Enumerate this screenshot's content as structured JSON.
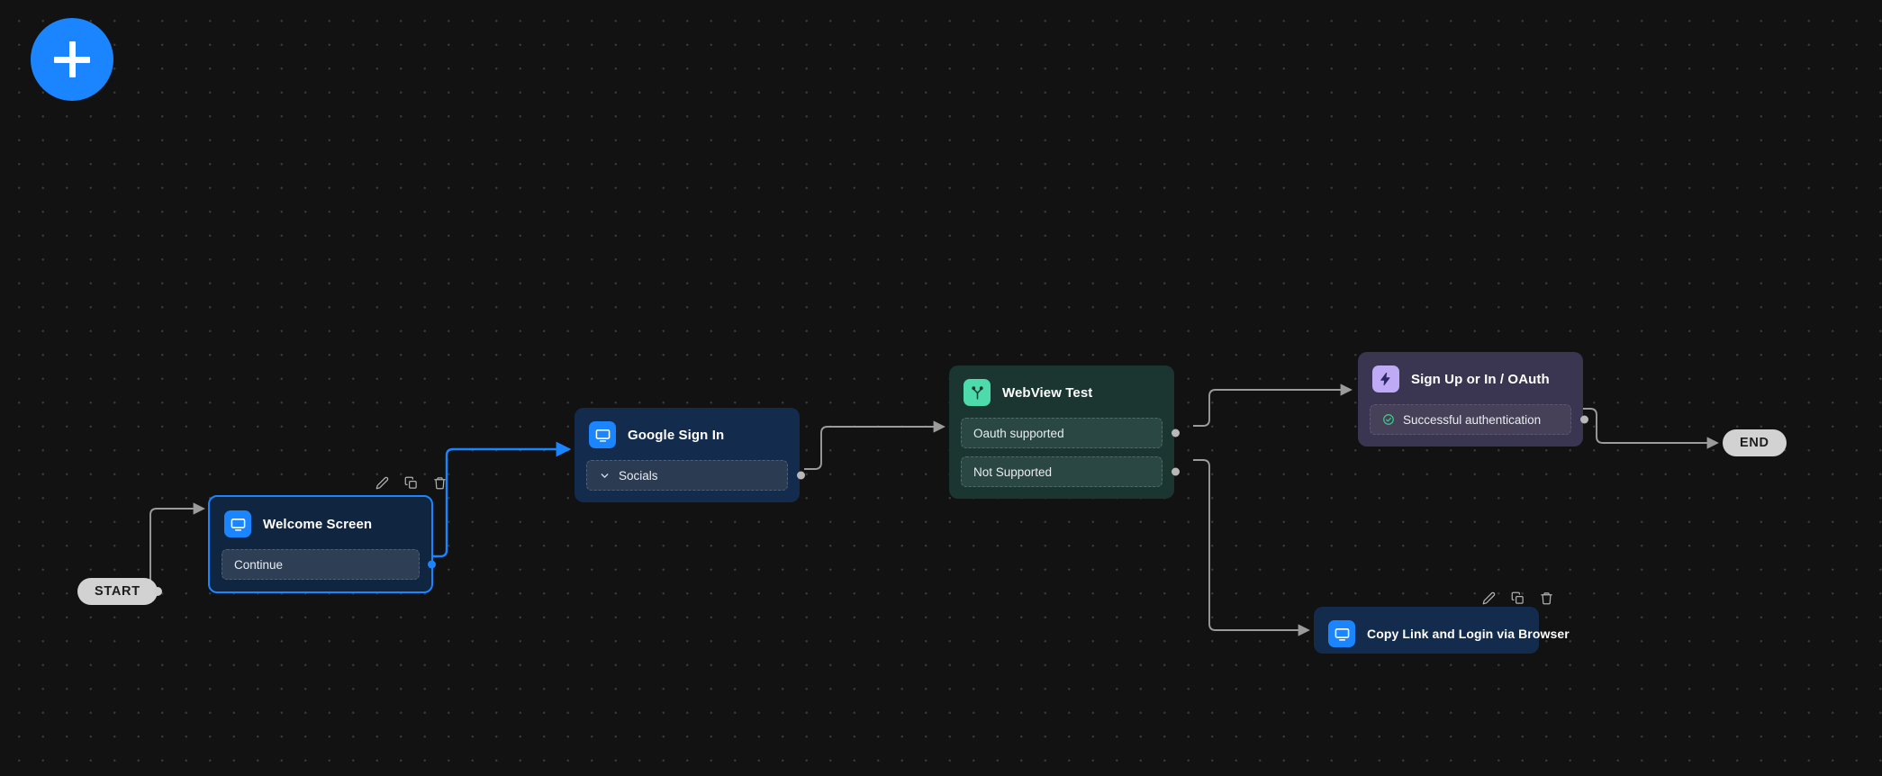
{
  "toolbar_add": {
    "label": "+",
    "icon": "plus-icon",
    "color": "#1a85ff"
  },
  "terminals": {
    "start": {
      "label": "START"
    },
    "end": {
      "label": "END"
    }
  },
  "node_toolbar": {
    "edit_label": "Edit",
    "duplicate_label": "Duplicate",
    "delete_label": "Delete",
    "icons": [
      "pencil-icon",
      "copy-icon",
      "trash-icon"
    ]
  },
  "nodes": [
    {
      "id": "welcome-screen",
      "title": "Welcome Screen",
      "type": "screen",
      "icon": "screen-icon",
      "selected": true,
      "rows": [
        {
          "label": "Continue",
          "icon": null
        }
      ]
    },
    {
      "id": "google-sign-in",
      "title": "Google Sign In",
      "type": "screen",
      "icon": "screen-icon",
      "selected": false,
      "rows": [
        {
          "label": "Socials",
          "icon": "chevron-down-icon"
        }
      ]
    },
    {
      "id": "webview-test",
      "title": "WebView Test",
      "type": "logic",
      "icon": "branch-icon",
      "selected": false,
      "rows": [
        {
          "label": "Oauth supported",
          "icon": null
        },
        {
          "label": "Not Supported",
          "icon": null
        }
      ]
    },
    {
      "id": "sign-up-oauth",
      "title": "Sign Up or In / OAuth",
      "type": "action",
      "icon": "bolt-icon",
      "selected": false,
      "rows": [
        {
          "label": "Successful authentication",
          "icon": "check-circle-icon"
        }
      ]
    },
    {
      "id": "copy-link-browser",
      "title": "Copy Link and Login via Browser",
      "type": "screen",
      "icon": "screen-icon",
      "selected": false,
      "rows": []
    }
  ],
  "colors": {
    "canvas_background": "#121212",
    "accent_blue": "#1a85ff",
    "edge_gray": "#9b9b9b",
    "edge_selected": "#1a85ff",
    "screen_node": "#132c4d",
    "logic_node": "#1b3531",
    "action_node": "#3a3550",
    "terminal_pill": "#d2d2d2",
    "success_green": "#3ecf8e"
  }
}
